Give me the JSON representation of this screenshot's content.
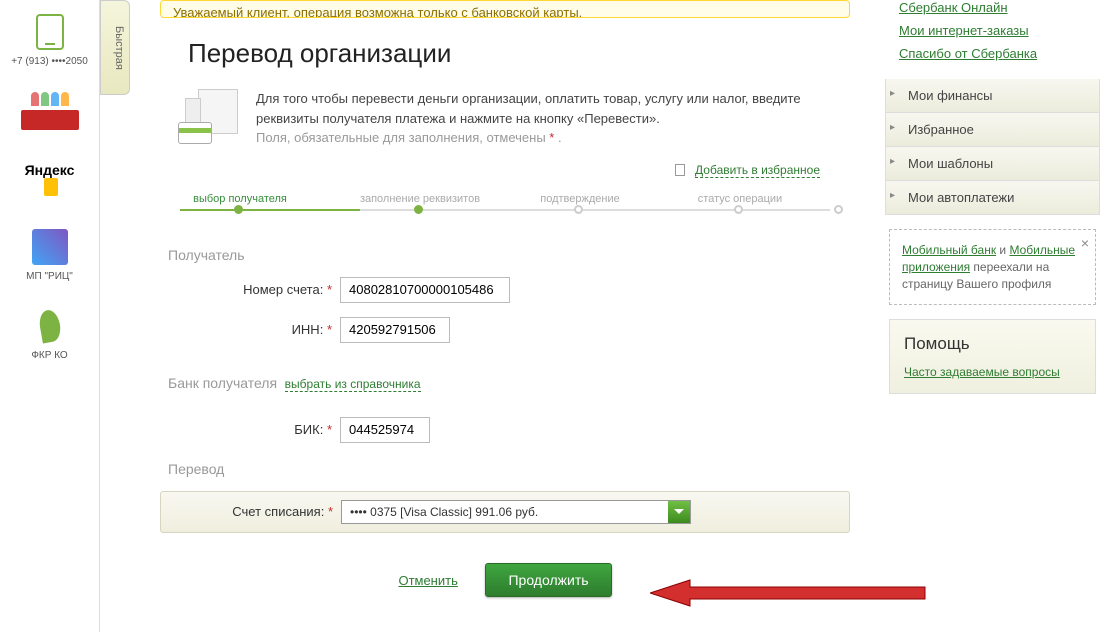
{
  "sidebar": {
    "quick_pay_tab": "Быстрая",
    "items": [
      {
        "label": "+7 (913) ••••2050"
      },
      {
        "label": ""
      },
      {
        "label": "Яндекс"
      },
      {
        "label": "МП \"РИЦ\""
      },
      {
        "label": "ФКР КО"
      }
    ]
  },
  "alert": "Уважаемый клиент, операция возможна только с банковской карты.",
  "title": "Перевод организации",
  "intro": {
    "line1": "Для того чтобы перевести деньги организации, оплатить товар, услугу или налог, введите реквизиты получателя платежа и нажмите на кнопку «Перевести».",
    "line2": "Поля, обязательные для заполнения, отмечены ",
    "dot": "*",
    "dot_after": " ."
  },
  "fav_link": "Добавить в избранное",
  "steps": [
    "выбор получателя",
    "заполнение реквизитов",
    "подтверждение",
    "статус операции"
  ],
  "sections": {
    "recipient": "Получатель",
    "bank": "Банк получателя",
    "dir_link": "выбрать из справочника",
    "transfer": "Перевод"
  },
  "fields": {
    "account_label": "Номер счета:",
    "account_value": "40802810700000105486",
    "inn_label": "ИНН:",
    "inn_value": "420592791506",
    "bik_label": "БИК:",
    "bik_value": "044525974",
    "from_label": "Счет списания:",
    "from_value": "•••• 0375 [Visa Classic] 991.06 руб."
  },
  "actions": {
    "cancel": "Отменить",
    "continue": "Продолжить"
  },
  "right": {
    "top_links": [
      "Сбербанк Онлайн",
      "Мои интернет-заказы",
      "Спасибо от Сбербанка"
    ],
    "panels": [
      "Мои финансы",
      "Избранное",
      "Мои шаблоны",
      "Мои автоплатежи"
    ],
    "notice": {
      "a1": "Мобильный банк",
      "sep": " и ",
      "a2": "Мобильные приложения",
      "rest": " переехали на страницу Вашего профиля"
    },
    "help_title": "Помощь",
    "help_link": "Часто задаваемые вопросы"
  }
}
